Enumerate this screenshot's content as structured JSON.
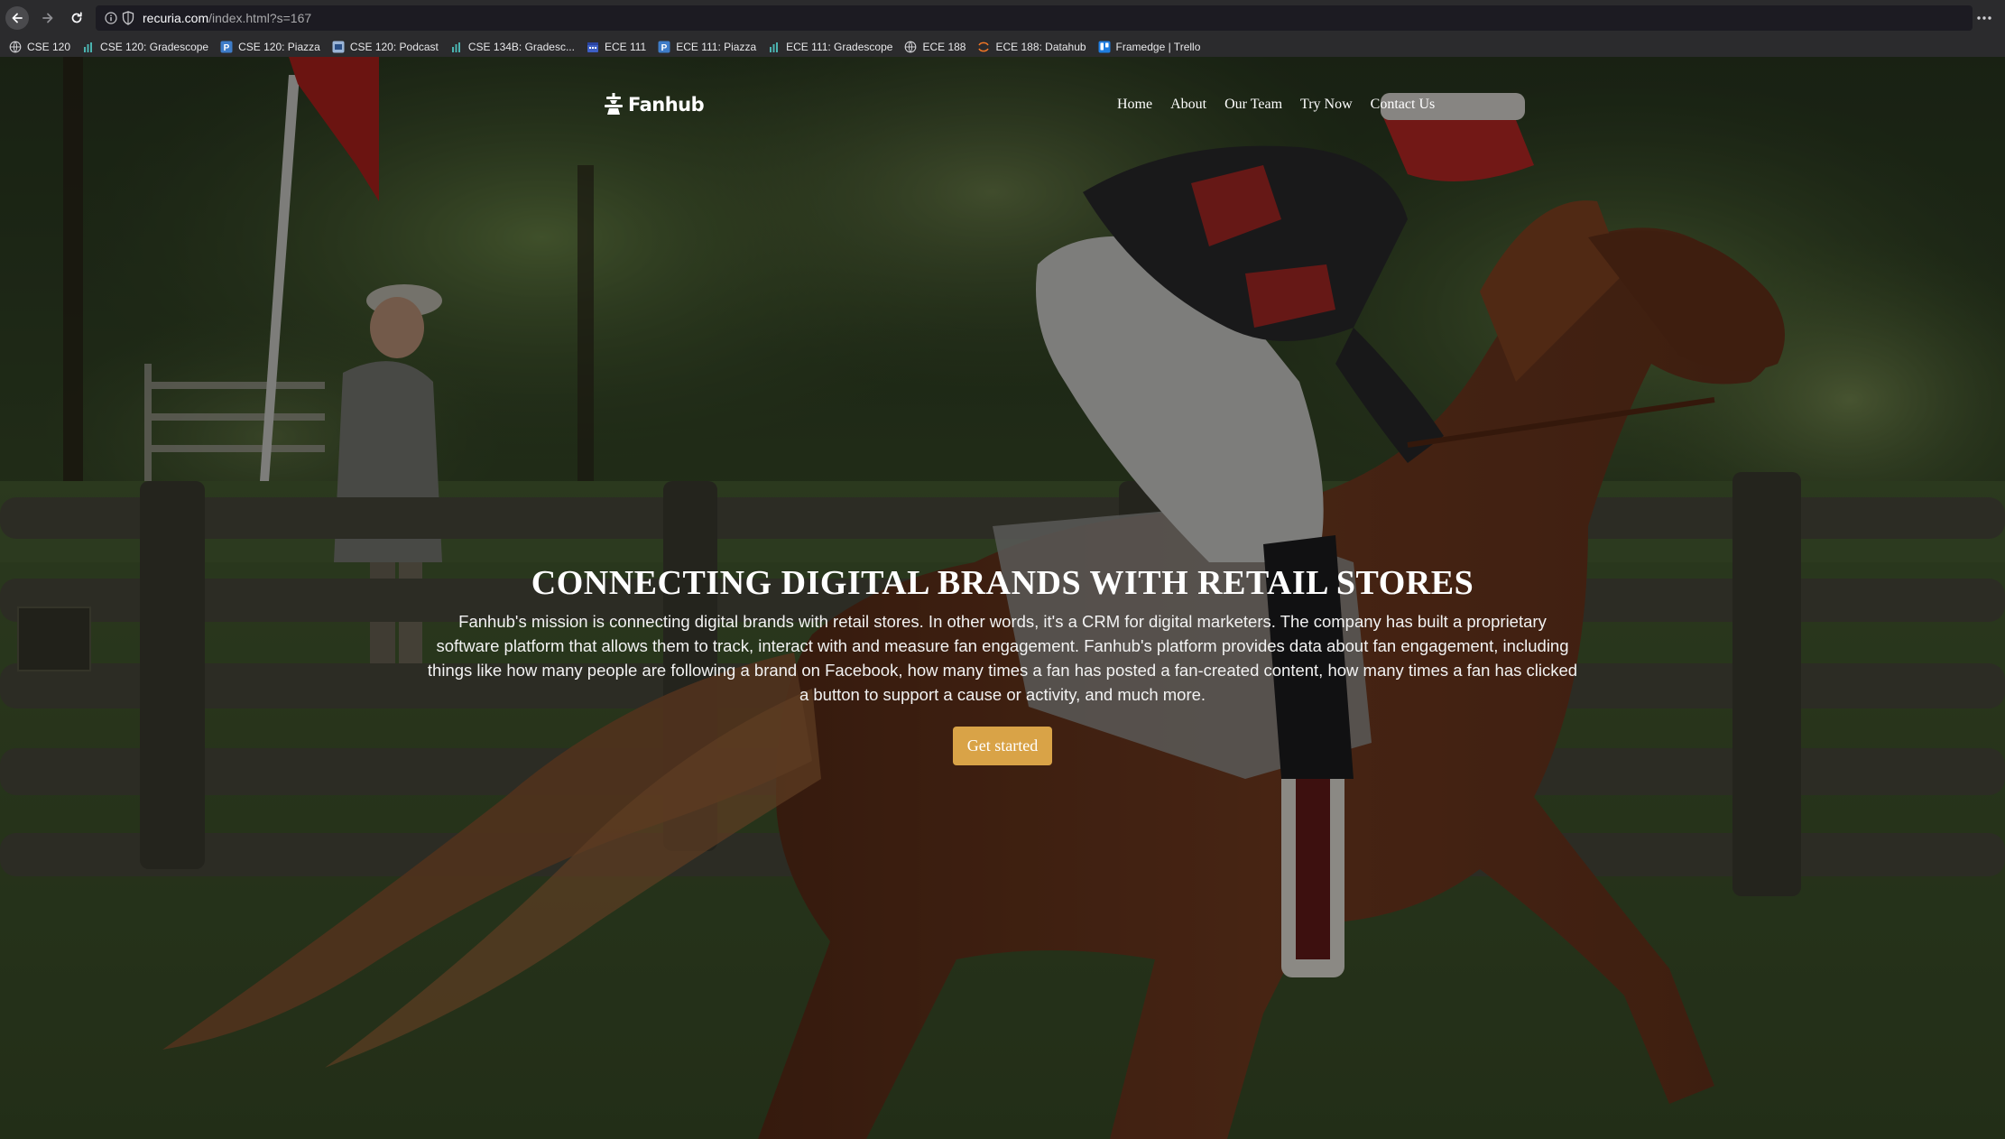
{
  "browser": {
    "url_domain": "recuria.com",
    "url_path": "/index.html?s=167",
    "bookmarks": [
      {
        "label": "CSE 120",
        "icon": "globe-icon"
      },
      {
        "label": "CSE 120: Gradescope",
        "icon": "gradescope-icon"
      },
      {
        "label": "CSE 120: Piazza",
        "icon": "piazza-icon"
      },
      {
        "label": "CSE 120: Podcast",
        "icon": "podcast-icon"
      },
      {
        "label": "CSE 134B: Gradesc...",
        "icon": "gradescope-icon"
      },
      {
        "label": "ECE 111",
        "icon": "calendar-icon"
      },
      {
        "label": "ECE 111: Piazza",
        "icon": "piazza-icon"
      },
      {
        "label": "ECE 111: Gradescope",
        "icon": "gradescope-icon"
      },
      {
        "label": "ECE 188",
        "icon": "globe-icon"
      },
      {
        "label": "ECE 188: Datahub",
        "icon": "jupyter-icon"
      },
      {
        "label": "Framedge | Trello",
        "icon": "trello-icon"
      }
    ]
  },
  "site": {
    "logo_text": "Fanhub",
    "nav": [
      "Home",
      "About",
      "Our Team",
      "Try Now",
      "Contact Us"
    ],
    "hero": {
      "title": "CONNECTING DIGITAL BRANDS WITH RETAIL STORES",
      "description": "Fanhub's mission is connecting digital brands with retail stores. In other words, it's a CRM for digital marketers. The company has built a proprietary software platform that allows them to track, interact with and measure fan engagement. Fanhub's platform provides data about fan engagement, including things like how many people are following a brand on Facebook, how many times a fan has posted a fan-created content, how many times a fan has clicked a button to support a cause or activity, and much more.",
      "cta_label": "Get started"
    },
    "background_image": "horse-racing-photo",
    "accent_color": "#d9a347"
  }
}
